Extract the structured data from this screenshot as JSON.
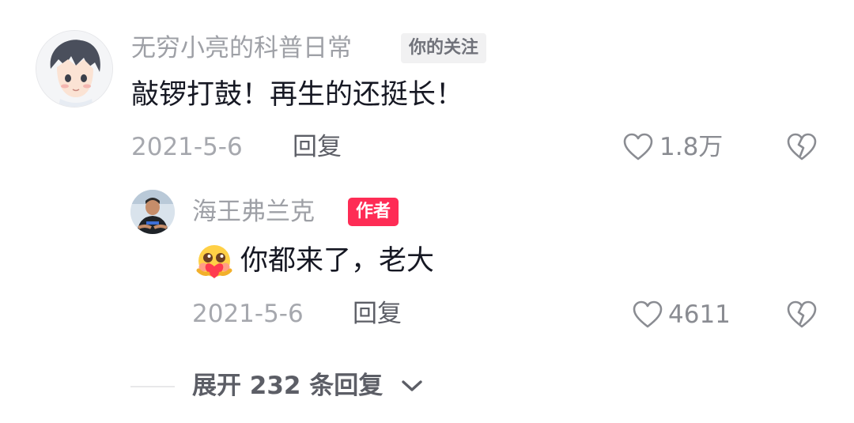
{
  "comment": {
    "user_name": "无穷小亮的科普日常",
    "follow_badge": "你的关注",
    "text": "敲锣打鼓！再生的还挺长！",
    "date": "2021-5-6",
    "reply_label": "回复",
    "like_count": "1.8万"
  },
  "reply": {
    "user_name": "海王弗兰克",
    "author_badge": "作者",
    "text": "你都来了，老大",
    "date": "2021-5-6",
    "reply_label": "回复",
    "like_count": "4611"
  },
  "expand": {
    "label": "展开 232 条回复"
  },
  "colors": {
    "accent": "#fe2c55",
    "secondary_text": "#9ea0a6"
  }
}
